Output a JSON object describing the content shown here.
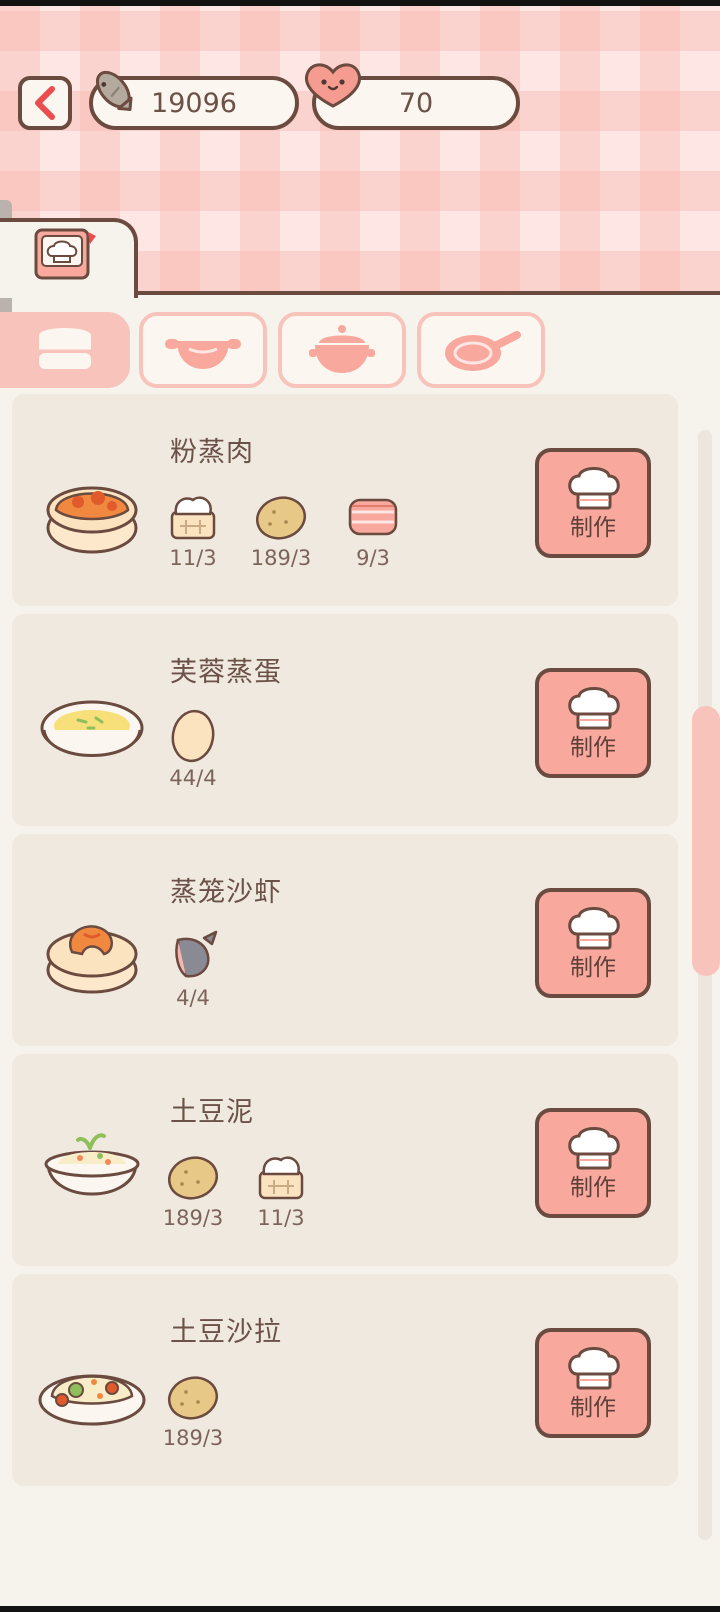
{
  "currency": {
    "fish_value": "19096",
    "heart_value": "70"
  },
  "icons": {
    "back": "back-arrow-icon",
    "fish": "fish-icon",
    "heart": "heart-icon",
    "category": "recipe-book-icon"
  },
  "tools": [
    {
      "name": "steamer",
      "icon": "steamer-icon",
      "active": true
    },
    {
      "name": "wok",
      "icon": "wok-icon",
      "active": false
    },
    {
      "name": "pot",
      "icon": "pot-icon",
      "active": false
    },
    {
      "name": "pan",
      "icon": "frying-pan-icon",
      "active": false
    }
  ],
  "recipes": [
    {
      "name": "粉蒸肉",
      "dish_icon": "steamed-pork-icon",
      "make_label": "制作",
      "ingredients": [
        {
          "icon": "rice-bun-icon",
          "count": "11/3"
        },
        {
          "icon": "potato-icon",
          "count": "189/3"
        },
        {
          "icon": "meat-icon",
          "count": "9/3"
        }
      ]
    },
    {
      "name": "芙蓉蒸蛋",
      "dish_icon": "steamed-egg-icon",
      "make_label": "制作",
      "ingredients": [
        {
          "icon": "egg-icon",
          "count": "44/4"
        }
      ]
    },
    {
      "name": "蒸笼沙虾",
      "dish_icon": "steamed-shrimp-icon",
      "make_label": "制作",
      "ingredients": [
        {
          "icon": "fish-chunk-icon",
          "count": "4/4"
        }
      ]
    },
    {
      "name": "土豆泥",
      "dish_icon": "mashed-potato-icon",
      "make_label": "制作",
      "ingredients": [
        {
          "icon": "potato-icon",
          "count": "189/3"
        },
        {
          "icon": "rice-bun-icon",
          "count": "11/3"
        }
      ]
    },
    {
      "name": "土豆沙拉",
      "dish_icon": "potato-salad-icon",
      "make_label": "制作",
      "ingredients": [
        {
          "icon": "potato-icon",
          "count": "189/3"
        }
      ]
    }
  ],
  "colors": {
    "accent": "#f8a89d",
    "outline": "#6b4a3f",
    "card": "#efe9df",
    "background": "#f6f3ec"
  }
}
